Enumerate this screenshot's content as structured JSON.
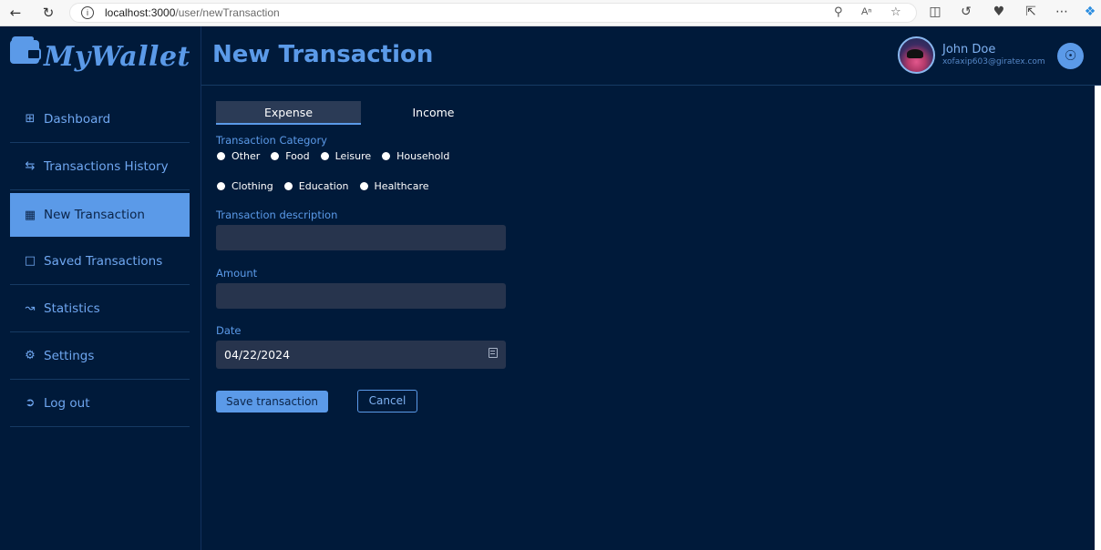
{
  "browser": {
    "url_host": "localhost:3000",
    "url_path": "/user/newTransaction"
  },
  "app": {
    "logo_text": "MyWallet"
  },
  "sidebar": {
    "items": [
      {
        "label": "Dashboard",
        "icon": "grid-icon"
      },
      {
        "label": "Transactions History",
        "icon": "arrows-exchange-icon"
      },
      {
        "label": "New Transaction",
        "icon": "calendar-plus-icon",
        "active": true
      },
      {
        "label": "Saved Transactions",
        "icon": "bookmark-icon"
      },
      {
        "label": "Statistics",
        "icon": "chart-line-icon"
      },
      {
        "label": "Settings",
        "icon": "gear-icon"
      },
      {
        "label": "Log out",
        "icon": "logout-icon"
      }
    ]
  },
  "header": {
    "title": "New Transaction",
    "user_name": "John Doe",
    "user_email": "xofaxip603@giratex.com"
  },
  "form": {
    "tabs": [
      {
        "label": "Expense",
        "active": true
      },
      {
        "label": "Income",
        "active": false
      }
    ],
    "category_label": "Transaction Category",
    "categories": [
      "Other",
      "Food",
      "Leisure",
      "Household",
      "Clothing",
      "Education",
      "Healthcare"
    ],
    "description_label": "Transaction description",
    "description_value": "",
    "amount_label": "Amount",
    "amount_value": "",
    "date_label": "Date",
    "date_value": "04/22/2024",
    "save_label": "Save transaction",
    "cancel_label": "Cancel"
  },
  "colors": {
    "background": "#001a3a",
    "accent": "#5b9ae8",
    "input_bg": "#27344d"
  }
}
